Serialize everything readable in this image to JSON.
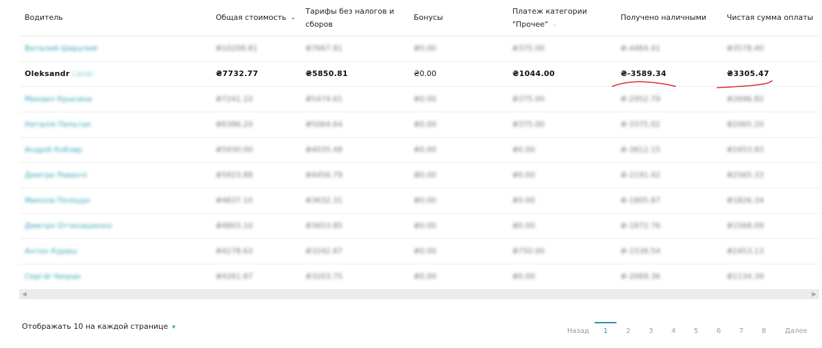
{
  "columns": [
    {
      "label": "Водитель"
    },
    {
      "label": "Общая стоимость"
    },
    {
      "label": "Тарифы без налогов и сборов"
    },
    {
      "label": "Бонусы"
    },
    {
      "label": "Платеж категории \"Прочее\""
    },
    {
      "label": "Получено наличными"
    },
    {
      "label": "Чистая сумма оплаты"
    }
  ],
  "rows": [
    {
      "driver": "Виталий Шарулий",
      "total": "₴10208.81",
      "fares": "₴7667.81",
      "bonus": "₴0.00",
      "other": "₴375.00",
      "cash": "₴-4464.41",
      "net": "₴3578.40"
    },
    {
      "driver": "Oleksandr",
      "driver_faded": "Lazar",
      "total": "₴7732.77",
      "fares": "₴5850.81",
      "bonus": "₴0.00",
      "other": "₴1044.00",
      "cash": "₴-3589.34",
      "net": "₴3305.47"
    },
    {
      "driver": "Михаил Крысина",
      "total": "₴7241.10",
      "fares": "₴5474.61",
      "bonus": "₴0.00",
      "other": "₴375.00",
      "cash": "₴-2952.79",
      "net": "₴2696.82"
    },
    {
      "driver": "Наталія Пильтак",
      "total": "₴6386.20",
      "fares": "₴5064.64",
      "bonus": "₴0.00",
      "other": "₴375.00",
      "cash": "₴-3375.02",
      "net": "₴2065.20"
    },
    {
      "driver": "Андрій Кобзар",
      "total": "₴5930.00",
      "fares": "₴4035.48",
      "bonus": "₴0.00",
      "other": "₴0.00",
      "cash": "₴-3812.15",
      "net": "₴1653.83"
    },
    {
      "driver": "Дмитро Ревенчі",
      "total": "₴5923.88",
      "fares": "₴4456.79",
      "bonus": "₴0.00",
      "other": "₴0.00",
      "cash": "₴-2191.42",
      "net": "₴2565.33"
    },
    {
      "driver": "Микола Поліщук",
      "total": "₴4837.10",
      "fares": "₴3632.31",
      "bonus": "₴0.00",
      "other": "₴0.00",
      "cash": "₴-1805.87",
      "net": "₴1826.34"
    },
    {
      "driver": "Дмитро Отченашенко",
      "total": "₴4803.10",
      "fares": "₴3653.85",
      "bonus": "₴0.00",
      "other": "₴0.00",
      "cash": "₴-1872.76",
      "net": "₴1568.09"
    },
    {
      "driver": "Антон Кураш",
      "total": "₴4278.63",
      "fares": "₴3242.87",
      "bonus": "₴0.00",
      "other": "₴750.00",
      "cash": "₴-1538.54",
      "net": "₴2453.13"
    },
    {
      "driver": "Сергій Чекрак",
      "total": "₴4261.87",
      "fares": "₴3203.75",
      "bonus": "₴0.00",
      "other": "₴0.00",
      "cash": "₴-2069.36",
      "net": "₴1134.39"
    }
  ],
  "footer": {
    "page_size_label": "Отображать 10 на каждой странице",
    "prev_label": "Назад",
    "pages": [
      "1",
      "2",
      "3",
      "4",
      "5",
      "6",
      "7",
      "8"
    ],
    "next_label": "Далее"
  },
  "colors": {
    "accent": "#2a8fa0",
    "annotation": "#d92b2b"
  }
}
